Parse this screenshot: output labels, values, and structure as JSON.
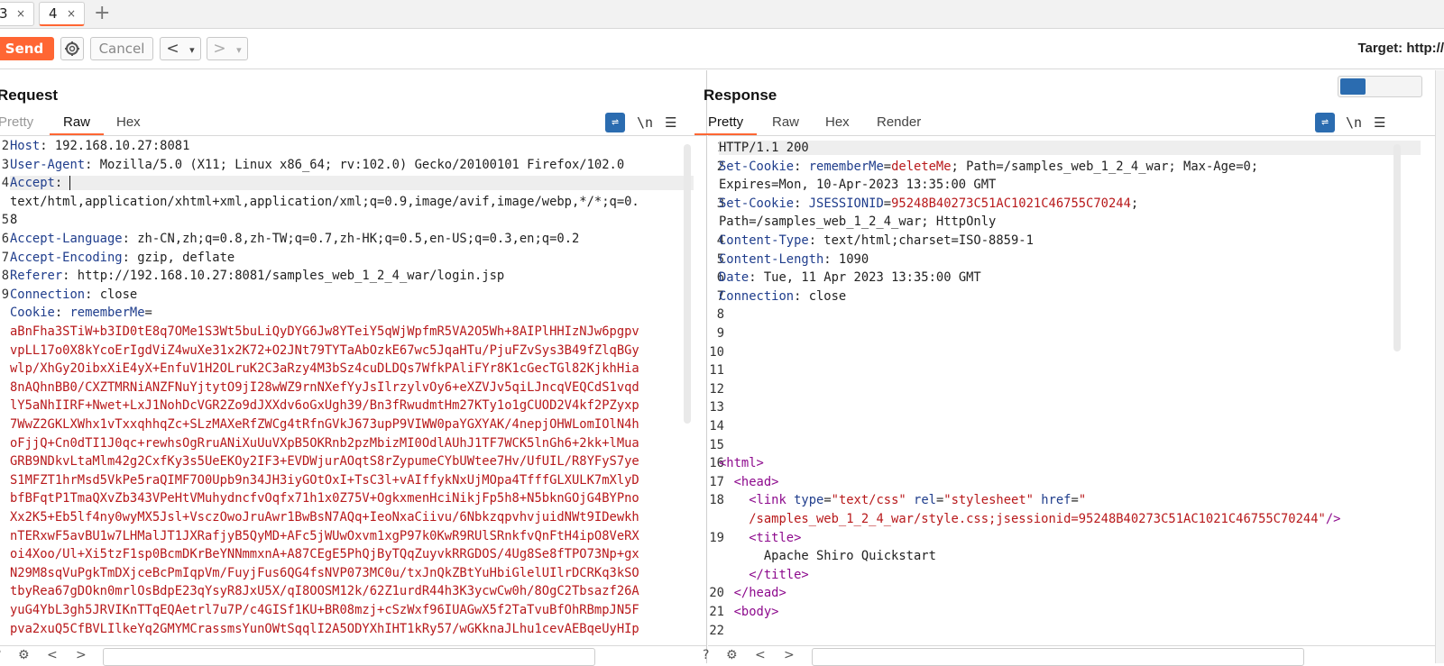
{
  "tabs": [
    {
      "label": "3",
      "close": "×"
    },
    {
      "label": "4",
      "close": "×"
    }
  ],
  "tab_add": "+",
  "toolbar": {
    "send": "Send",
    "cancel": "Cancel",
    "back": "<",
    "back_menu": "▾",
    "forward": ">",
    "forward_menu": "▾",
    "target": "Target: http://"
  },
  "request": {
    "title": "Request",
    "tabs": [
      "Pretty",
      "Raw",
      "Hex"
    ],
    "active_tab": "Raw",
    "newline_toggle": "\\n",
    "menu": "☰",
    "line_numbers": [
      "2",
      "3",
      "4",
      "",
      "5",
      "6",
      "7",
      "8",
      "9",
      "",
      "",
      "",
      "",
      "",
      "",
      "",
      "",
      "",
      "",
      "",
      "",
      "",
      "",
      "",
      "",
      "",
      "",
      ""
    ],
    "lines": [
      {
        "h": "Host",
        "v": " 192.168.10.27:8081"
      },
      {
        "h": "User-Agent",
        "v": " Mozilla/5.0 (X11; Linux x86_64; rv:102.0) Gecko/20100101 Firefox/102.0"
      },
      {
        "h": "Accept",
        "v": " "
      },
      {
        "h": "",
        "v": "text/html,application/xhtml+xml,application/xml;q=0.9,image/avif,image/webp,*/*;q=0."
      },
      {
        "h": "",
        "v": "8"
      },
      {
        "h": "Accept-Language",
        "v": " zh-CN,zh;q=0.8,zh-TW;q=0.7,zh-HK;q=0.5,en-US;q=0.3,en;q=0.2"
      },
      {
        "h": "Accept-Encoding",
        "v": " gzip, deflate"
      },
      {
        "h": "Referer",
        "v": " http://192.168.10.27:8081/samples_web_1_2_4_war/login.jsp"
      },
      {
        "h": "Connection",
        "v": " close"
      },
      {
        "h": "Cookie",
        "v": " rememberMe="
      }
    ],
    "cookie_lines": [
      "aBnFha3STiW+b3ID0tE8q7OMe1S3Wt5buLiQyDYG6Jw8YTeiY5qWjWpfmR5VA2O5Wh+8AIPlHHIzNJw6pgpv",
      "vpLL17o0X8kYcoErIgdViZ4wuXe31x2K72+O2JNt79TYTaAbOzkE67wc5JqaHTu/PjuFZvSys3B49fZlqBGy",
      "wlp/XhGy2OibxXiE4yX+EnfuV1H2OLruK2C3aRzy4M3bSz4cuDLDQs7WfkPAliFYr8K1cGecTGl82KjkhHia",
      "8nAQhnBB0/CXZTMRNiANZFNuYjtytO9jI28wWZ9rnNXefYyJsIlrzylvOy6+eXZVJv5qiLJncqVEQCdS1vqd",
      "lY5aNhIIRF+Nwet+LxJ1NohDcVGR2Zo9dJXXdv6oGxUgh39/Bn3fRwudmtHm27KTy1o1gCUOD2V4kf2PZyxp",
      "7WwZ2GKLXWhx1vTxxqhhqZc+SLzMAXeRfZWCg4tRfnGVkJ673upP9VIWW0paYGXYAK/4nepjOHWLomIOlN4h",
      "oFjjQ+Cn0dTI1J0qc+rewhsOgRruANiXuUuVXpB5OKRnb2pzMbizMI0OdlAUhJ1TF7WCK5lnGh6+2kk+lMua",
      "GRB9NDkvLtaMlm42g2CxfKy3s5UeEKOy2IF3+EVDWjurAOqtS8rZypumeCYbUWtee7Hv/UfUIL/R8YFyS7ye",
      "S1MFZT1hrMsd5VkPe5raQIMF7O0Upb9n34JH3iyGOtOxI+TsC3l+vAIffykNxUjMOpa4TfffGLXULK7mXlyD",
      "bfBFqtP1TmaQXvZb343VPeHtVMuhydncfvOqfx71h1x0Z75V+OgkxmenHciNikjFp5h8+N5bknGOjG4BYPno",
      "Xx2K5+Eb5lf4ny0wyMX5Jsl+VsczOwoJruAwr1BwBsN7AQq+IeoNxaCiivu/6NbkzqpvhvjuidNWt9IDewkh",
      "nTERxwF5avBU1w7LHMalJT1JXRafjyB5QyMD+AFc5jWUwOxvm1xgP97k0KwR9RUlSRnkfvQnFtH4ipO8VeRX",
      "oi4Xoo/Ul+Xi5tzF1sp0BcmDKrBeYNNmmxnA+A87CEgE5PhQjByTQqZuyvkRRGDOS/4Ug8Se8fTPO73Np+gx",
      "N29M8sqVuPgkTmDXjceBcPmIqpVm/FuyjFus6QG4fsNVP073MC0u/txJnQkZBtYuHbiGlelUIlrDCRKq3kSO",
      "tbyRea67gDOkn0mrlOsBdpE23qYsyR8JxU5X/qI8OOSM12k/62Z1urdR44h3K3ycwCw0h/8OgC2Tbsazf26A",
      "yuG4YbL3gh5JRVIKnTTqEQAetrl7u7P/c4GISf1KU+BR08mzj+cSzWxf96IUAGwX5f2TaTvuBfOhRBmpJN5F",
      "pva2xuQ5CfBVLIlkeYq2GMYMCrassmsYunOWtSqqlI2A5ODYXhIHT1kRy57/wGKknaJLhu1cevAEBqeUyHIp"
    ]
  },
  "response": {
    "title": "Response",
    "tabs": [
      "Pretty",
      "Raw",
      "Hex",
      "Render"
    ],
    "active_tab": "Pretty",
    "newline_toggle": "\\n",
    "menu": "☰",
    "line_numbers": [
      "1",
      "2",
      "",
      "3",
      "",
      "4",
      "5",
      "6",
      "7",
      "8",
      "9",
      "10",
      "11",
      "12",
      "13",
      "14",
      "15",
      "16",
      "17",
      "18",
      "",
      "19",
      "",
      "",
      "20",
      "21",
      "22"
    ],
    "status_line": "HTTP/1.1 200",
    "set_cookie_1": {
      "h": "Set-Cookie",
      "name": "rememberMe",
      "eq": "=",
      "val": "deleteMe",
      "rest": "; Path=/samples_web_1_2_4_war; Max-Age=0;"
    },
    "set_cookie_1_cont": "Expires=Mon, 10-Apr-2023 13:35:00 GMT",
    "set_cookie_2": {
      "h": "Set-Cookie",
      "name": "JSESSIONID",
      "eq": "=",
      "val": "95248B40273C51AC1021C46755C70244",
      "rest": ";"
    },
    "set_cookie_2_cont": "Path=/samples_web_1_2_4_war; HttpOnly",
    "content_type": {
      "h": "Content-Type",
      "v": " text/html;charset=ISO-8859-1"
    },
    "content_length": {
      "h": "Content-Length",
      "v": " 1090"
    },
    "date": {
      "h": "Date",
      "v": " Tue, 11 Apr 2023 13:35:00 GMT"
    },
    "connection": {
      "h": "Connection",
      "v": " close"
    },
    "html_open": "<html>",
    "head_open": "<head>",
    "link_tag": "<link",
    "link_type_attr": "type",
    "link_type_val": "\"text/css\"",
    "link_rel_attr": "rel",
    "link_rel_val": "\"stylesheet\"",
    "link_href_attr": "href",
    "link_href_open": "\"",
    "link_href_val": "/samples_web_1_2_4_war/style.css;jsessionid=95248B40273C51AC1021C46755C70244\"",
    "link_close": "/>",
    "title_open": "<title>",
    "title_text": "Apache Shiro Quickstart",
    "title_close": "</title>",
    "head_close": "</head>",
    "body_open": "<body>"
  },
  "colors": {
    "accent": "#ff6633",
    "header_name": "#1f3d8c",
    "cookie_value": "#b8191b",
    "html_tag": "#8d0a8d",
    "toggle_active": "#2b6cb0"
  }
}
